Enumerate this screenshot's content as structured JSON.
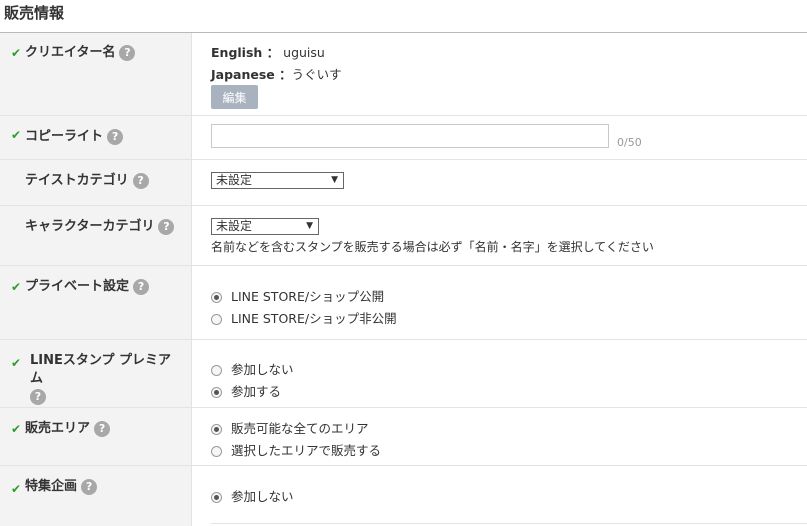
{
  "section_title": "販売情報",
  "creator": {
    "label": "クリエイター名",
    "en_label": "English ：",
    "en_value": "uguisu",
    "ja_label": "Japanese ：",
    "ja_value": "うぐいす",
    "edit_label": "編集"
  },
  "copyright": {
    "label": "コピーライト",
    "value": "",
    "counter": "0/50"
  },
  "taste": {
    "label": "テイストカテゴリ",
    "selected": "未設定"
  },
  "character": {
    "label": "キャラクターカテゴリ",
    "selected": "未設定",
    "note": "名前などを含むスタンプを販売する場合は必ず「名前・名字」を選択してください"
  },
  "private": {
    "label": "プライベート設定",
    "options": [
      "LINE STORE/ショップ公開",
      "LINE STORE/ショップ非公開"
    ],
    "selected_index": 0
  },
  "premium": {
    "label": "LINEスタンプ プレミアム",
    "options": [
      "参加しない",
      "参加する"
    ],
    "selected_index": 1
  },
  "area": {
    "label": "販売エリア",
    "options": [
      "販売可能な全てのエリア",
      "選択したエリアで販売する"
    ],
    "selected_index": 0
  },
  "special": {
    "label": "特集企画",
    "options": [
      "参加しない"
    ],
    "selected_index": 0
  },
  "icons": {
    "check": "check-icon",
    "help": "help-icon",
    "dropdown": "dropdown-arrow-icon"
  },
  "help_glyph": "?",
  "check_glyph": "✔",
  "arrow_glyph": "▼",
  "colors": {
    "check": "#2c9e2c",
    "help": "#a8a8a8",
    "edit_button": "#a9b3bf"
  }
}
